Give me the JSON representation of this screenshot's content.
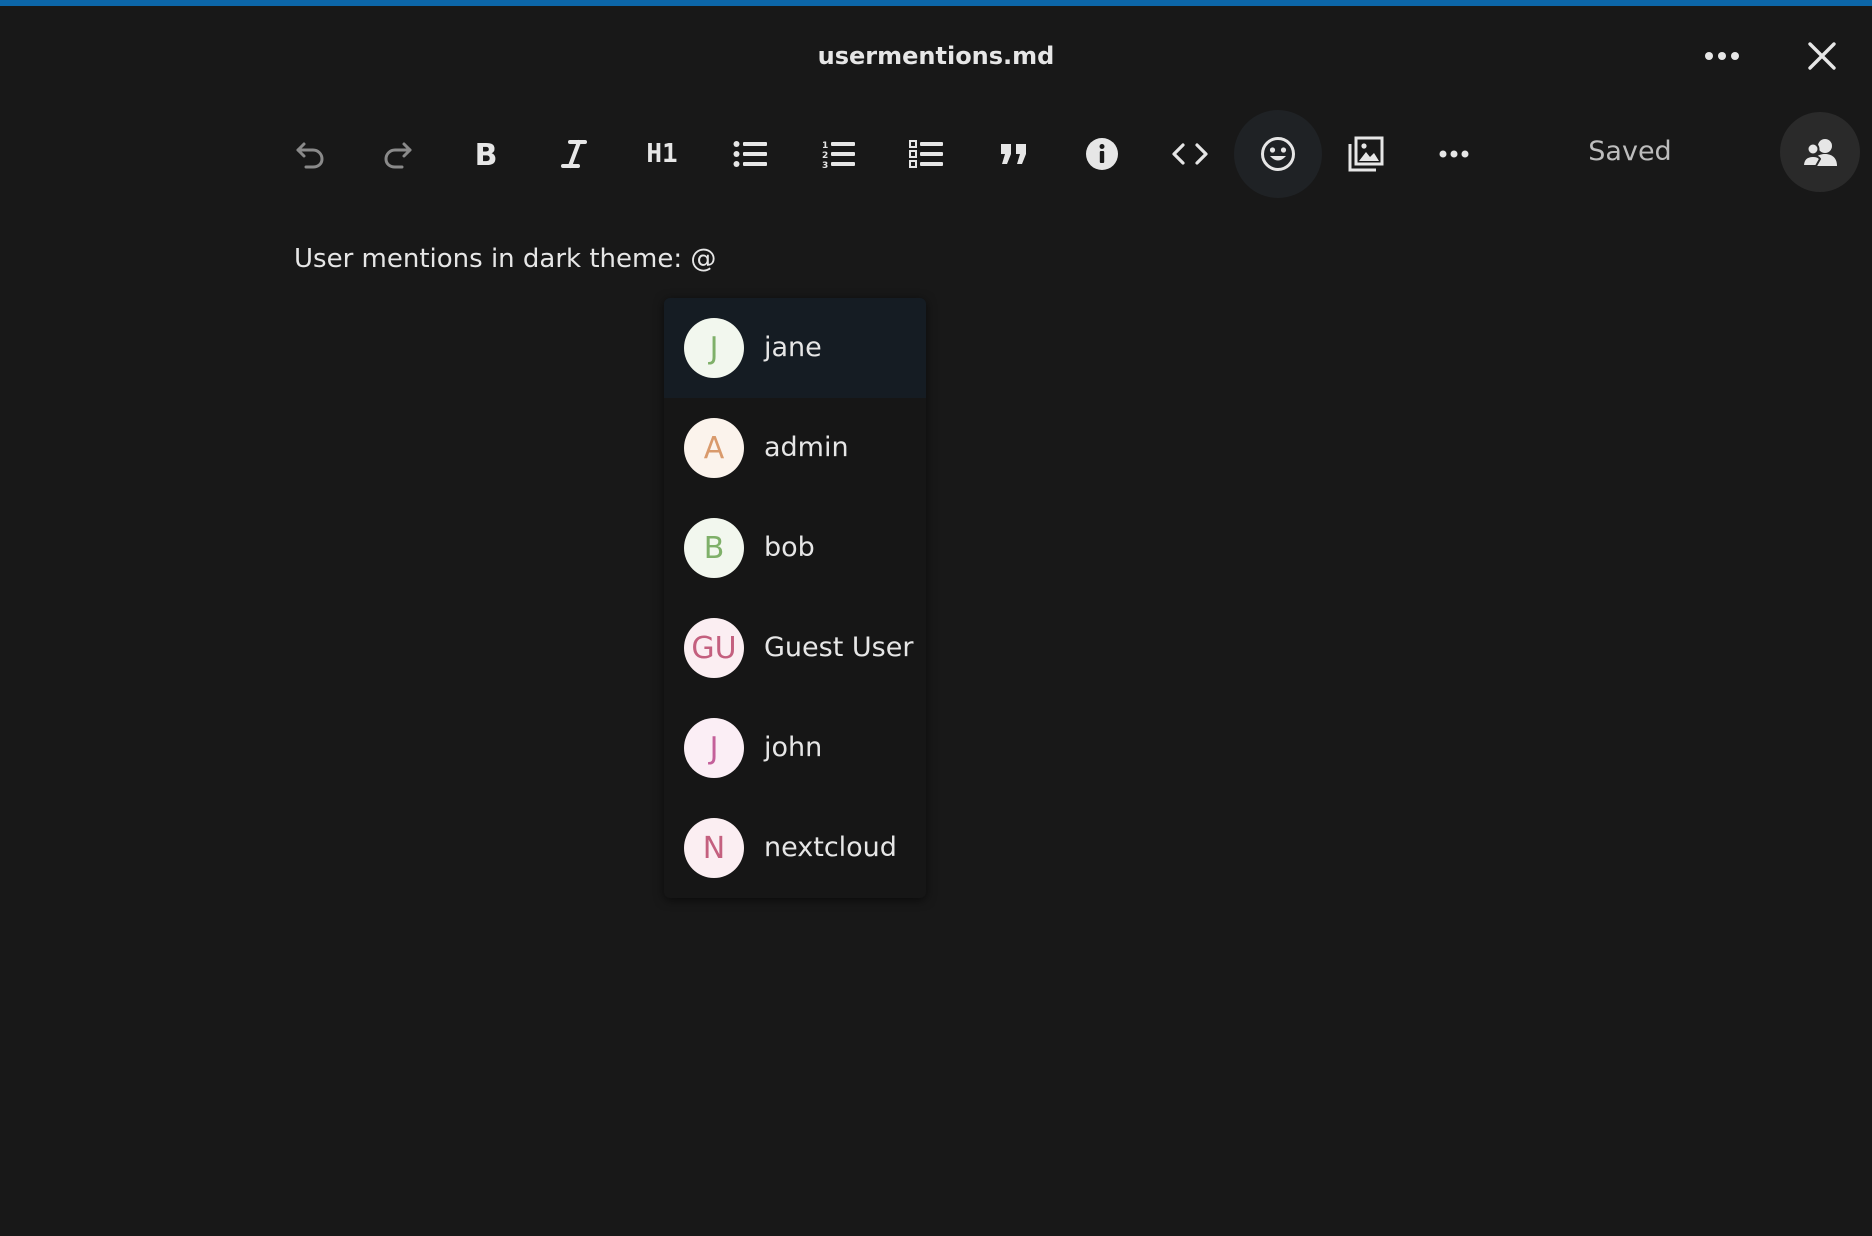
{
  "window": {
    "title": "usermentions.md",
    "accent_color": "#0c66a8"
  },
  "header": {
    "more_icon": "ellipsis-horizontal-icon",
    "close_icon": "close-icon"
  },
  "toolbar": {
    "buttons": [
      {
        "name": "undo",
        "icon": "undo-icon"
      },
      {
        "name": "redo",
        "icon": "redo-icon"
      },
      {
        "name": "bold",
        "icon": "bold-icon"
      },
      {
        "name": "italic",
        "icon": "italic-icon"
      },
      {
        "name": "heading",
        "icon": "heading-icon",
        "label": "H1"
      },
      {
        "name": "bullet-list",
        "icon": "bullet-list-icon"
      },
      {
        "name": "ordered-list",
        "icon": "ordered-list-icon"
      },
      {
        "name": "task-list",
        "icon": "checklist-icon"
      },
      {
        "name": "blockquote",
        "icon": "quote-icon"
      },
      {
        "name": "callout",
        "icon": "info-icon"
      },
      {
        "name": "code-block",
        "icon": "code-icon"
      },
      {
        "name": "emoji",
        "icon": "emoji-icon"
      },
      {
        "name": "insert-image",
        "icon": "image-gallery-icon"
      },
      {
        "name": "more-actions",
        "icon": "ellipsis-horizontal-icon"
      }
    ],
    "status": "Saved",
    "collab_icon": "users-icon"
  },
  "editor": {
    "content": "User mentions in dark theme: @"
  },
  "mention_popup": {
    "items": [
      {
        "initials": "J",
        "name": "jane",
        "avatar_bg": "#f2f7ee",
        "avatar_fg": "#7fb069",
        "selected": true
      },
      {
        "initials": "A",
        "name": "admin",
        "avatar_bg": "#fbf3ec",
        "avatar_fg": "#d99a6c",
        "selected": false
      },
      {
        "initials": "B",
        "name": "bob",
        "avatar_bg": "#f2f7ee",
        "avatar_fg": "#7fb069",
        "selected": false
      },
      {
        "initials": "GU",
        "name": "Guest User",
        "avatar_bg": "#fbeef2",
        "avatar_fg": "#c4607f",
        "selected": false
      },
      {
        "initials": "J",
        "name": "john",
        "avatar_bg": "#fbeef5",
        "avatar_fg": "#c4609a",
        "selected": false
      },
      {
        "initials": "N",
        "name": "nextcloud",
        "avatar_bg": "#fbeef2",
        "avatar_fg": "#c4607f",
        "selected": false
      }
    ]
  }
}
